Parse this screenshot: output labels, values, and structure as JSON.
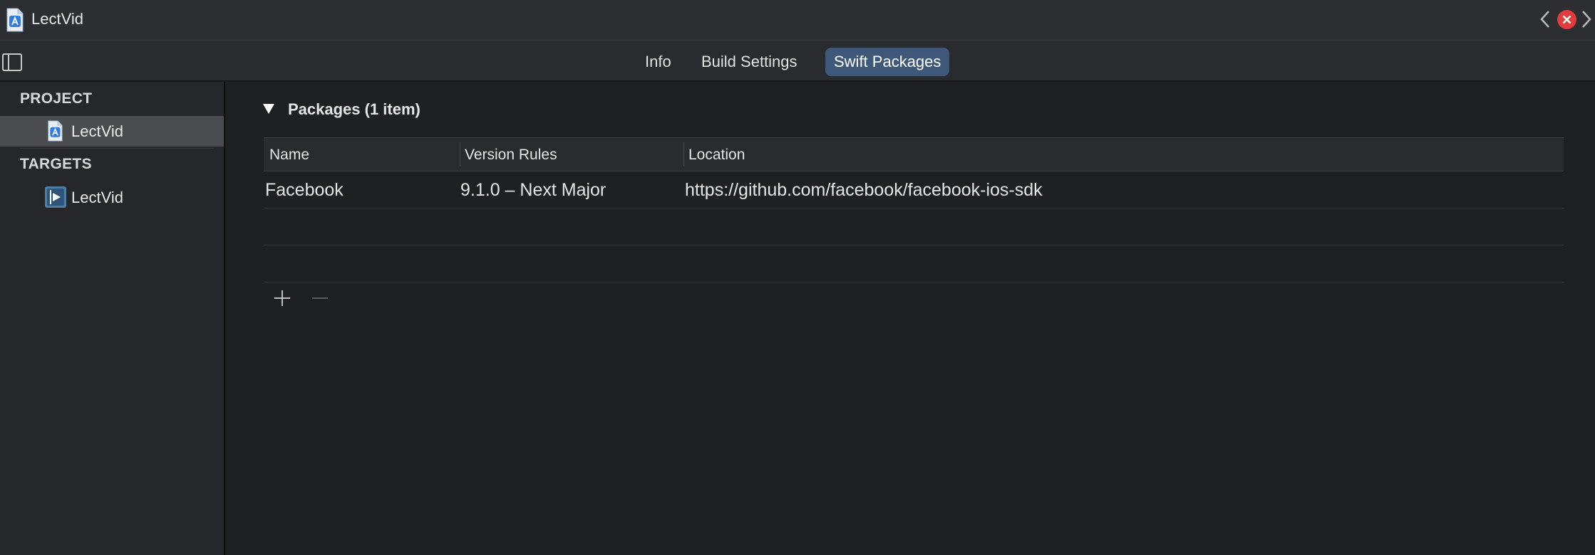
{
  "window": {
    "title": "LectVid"
  },
  "tabs": [
    {
      "label": "Info",
      "active": false
    },
    {
      "label": "Build Settings",
      "active": false
    },
    {
      "label": "Swift Packages",
      "active": true
    }
  ],
  "sidebar": {
    "project_header": "PROJECT",
    "project_item": "LectVid",
    "targets_header": "TARGETS",
    "target_item": "LectVid"
  },
  "packages": {
    "section_title": "Packages (1 item)",
    "columns": [
      "Name",
      "Version Rules",
      "Location"
    ],
    "rows": [
      {
        "name": "Facebook",
        "version_rules": "9.1.0 – Next Major",
        "location": "https://github.com/facebook/facebook-ios-sdk"
      }
    ]
  },
  "colors": {
    "accent_tab": "#3d5878",
    "close_button": "#e23b3b",
    "background": "#1f2022"
  },
  "icons": [
    "xcode-project-icon",
    "chevron-left-icon",
    "close-icon",
    "chevron-right-icon",
    "sidebar-toggle-icon",
    "app-target-icon",
    "disclosure-triangle-icon",
    "plus-icon",
    "minus-icon"
  ]
}
